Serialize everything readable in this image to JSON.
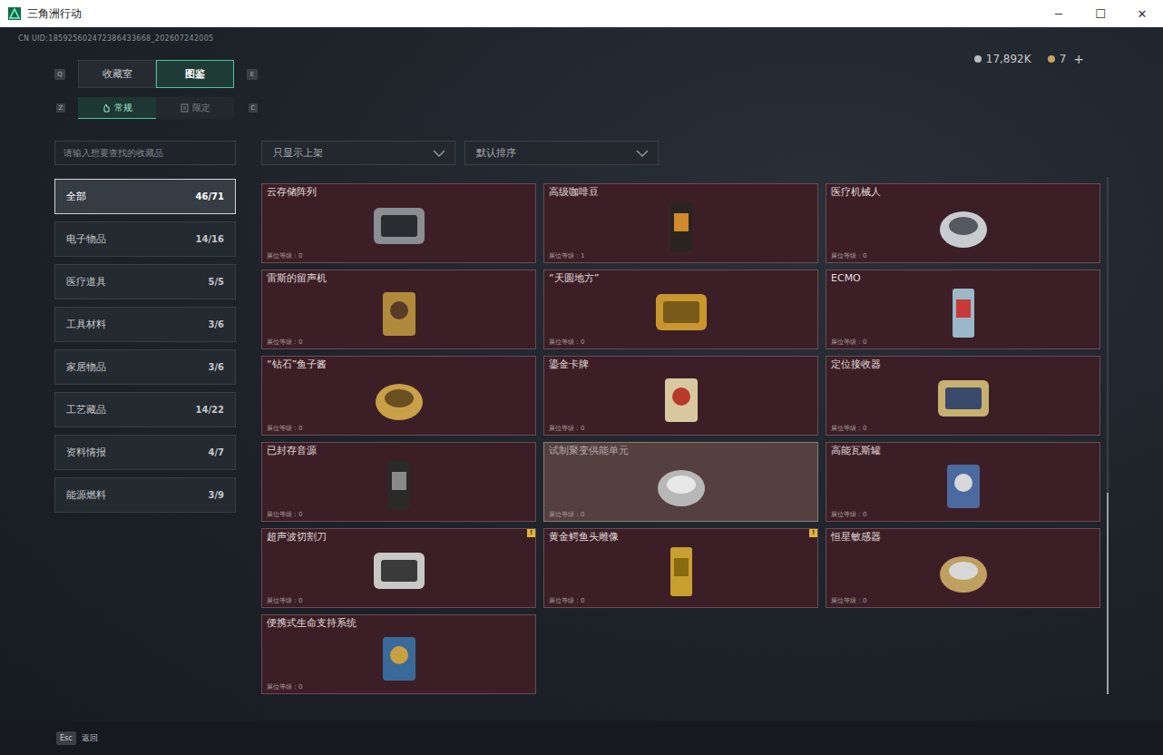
{
  "window": {
    "title": "三角洲行动",
    "controls": [
      "─",
      "☐",
      "✕"
    ]
  },
  "uid": "CN UID:185925602472386433668_202607242005",
  "tabs": {
    "prev_key": "Q",
    "next_key": "E",
    "items": [
      {
        "label": "收藏室",
        "selected": false
      },
      {
        "label": "图鉴",
        "selected": true
      }
    ]
  },
  "subtabs": {
    "prev_key": "Z",
    "next_key": "C",
    "items": [
      {
        "label": "常规",
        "selected": true
      },
      {
        "label": "限定",
        "selected": false
      }
    ]
  },
  "currency": [
    {
      "value": "17,892K",
      "color": "#b8bcc0"
    },
    {
      "value": "7",
      "color": "#c9a15a"
    }
  ],
  "add": "+",
  "search": {
    "placeholder": "请输入想要查找的收藏品"
  },
  "filters": [
    {
      "label": "只显示上架"
    },
    {
      "label": "默认排序"
    }
  ],
  "categories": [
    {
      "name": "全部",
      "count": "46/71",
      "selected": true
    },
    {
      "name": "电子物品",
      "count": "14/16",
      "selected": false
    },
    {
      "name": "医疗道具",
      "count": "5/5",
      "selected": false
    },
    {
      "name": "工具材料",
      "count": "3/6",
      "selected": false
    },
    {
      "name": "家居物品",
      "count": "3/6",
      "selected": false
    },
    {
      "name": "工艺藏品",
      "count": "14/22",
      "selected": false
    },
    {
      "name": "资料情报",
      "count": "4/7",
      "selected": false
    },
    {
      "name": "能源燃料",
      "count": "3/9",
      "selected": false
    }
  ],
  "alert_mark": "!",
  "items": [
    {
      "name": "云存储阵列",
      "level": "展位等级：0",
      "hovered": false,
      "alert": false
    },
    {
      "name": "高级咖啡豆",
      "level": "展位等级：1",
      "hovered": false,
      "alert": false
    },
    {
      "name": "医疗机械人",
      "level": "展位等级：0",
      "hovered": false,
      "alert": false
    },
    {
      "name": "雷斯的留声机",
      "level": "展位等级：0",
      "hovered": false,
      "alert": false
    },
    {
      "name": "“天圆地方”",
      "level": "展位等级：0",
      "hovered": false,
      "alert": false
    },
    {
      "name": "ECMO",
      "level": "展位等级：0",
      "hovered": false,
      "alert": false
    },
    {
      "name": "“钻石”鱼子酱",
      "level": "展位等级：0",
      "hovered": false,
      "alert": false
    },
    {
      "name": "鎏金卡牌",
      "level": "展位等级：0",
      "hovered": false,
      "alert": false
    },
    {
      "name": "定位接收器",
      "level": "展位等级：0",
      "hovered": false,
      "alert": false
    },
    {
      "name": "已封存音源",
      "level": "展位等级：0",
      "hovered": false,
      "alert": false
    },
    {
      "name": "试制聚变供能单元",
      "level": "展位等级：0",
      "hovered": true,
      "alert": false
    },
    {
      "name": "高能瓦斯罐",
      "level": "展位等级：0",
      "hovered": false,
      "alert": false
    },
    {
      "name": "超声波切割刀",
      "level": "展位等级：0",
      "hovered": false,
      "alert": true
    },
    {
      "name": "黄金鳄鱼头雕像",
      "level": "展位等级：0",
      "hovered": false,
      "alert": true
    },
    {
      "name": "恒星敏感器",
      "level": "展位等级：0",
      "hovered": false,
      "alert": false
    },
    {
      "name": "便携式生命支持系统",
      "level": "展位等级：0",
      "hovered": false,
      "alert": false
    }
  ],
  "scrollbar": {
    "level": 0.39
  },
  "footer": {
    "key": "Esc",
    "label": "返回"
  }
}
